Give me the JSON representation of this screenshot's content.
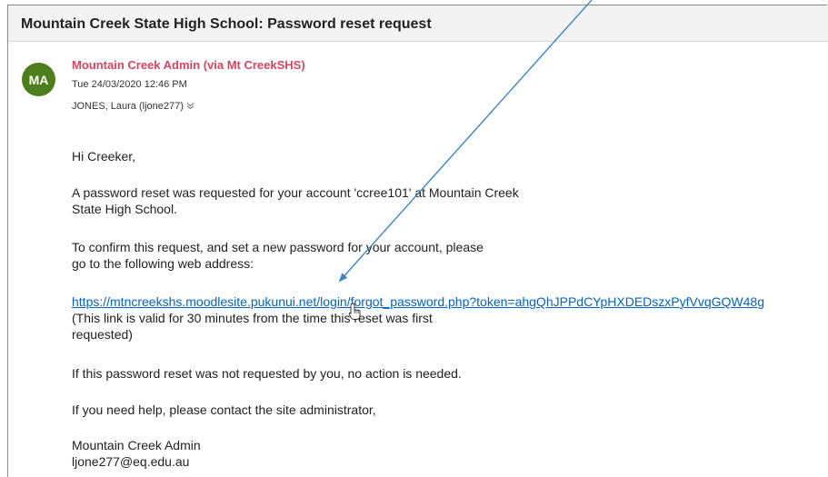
{
  "email": {
    "subject": "Mountain Creek State High School: Password reset request",
    "avatar_initials": "MA",
    "sender": "Mountain Creek Admin (via Mt CreekSHS)",
    "date": "Tue 24/03/2020 12:46 PM",
    "recipient": "JONES, Laura (ljone277)",
    "recipient_expand_icon": "chevron-double-down-icon",
    "body": {
      "greeting": "Hi Creeker,",
      "para1_line1": "A password reset was requested for your account 'ccree101' at Mountain Creek",
      "para1_line2": "State High School.",
      "para2_line1": "To confirm this request, and set a new password for your account, please",
      "para2_line2": "go to the following web address:",
      "link": "https://mtncreekshs.moodlesite.pukunui.net/login/forgot_password.php?token=ahgQhJPPdCYpHXDEDszxPyfVvqGQW48g",
      "validity_line1": "(This link is valid for 30 minutes from the time this reset was first",
      "validity_line2": "requested)",
      "para3": "If this password reset was not requested by you, no action is needed.",
      "para4": "If you need help, please contact the site administrator,",
      "signature_name": "Mountain Creek Admin",
      "signature_email": "ljone277@eq.edu.au"
    }
  },
  "overlay": {
    "annotation": "arrow-pointing-to-link",
    "cursor": "hand-pointer-icon"
  },
  "colors": {
    "sender": "#d9455f",
    "avatar": "#4e7d1b",
    "link": "#0563c1",
    "arrow": "#3b86c6",
    "subject_bar": "#f3f3f3"
  }
}
